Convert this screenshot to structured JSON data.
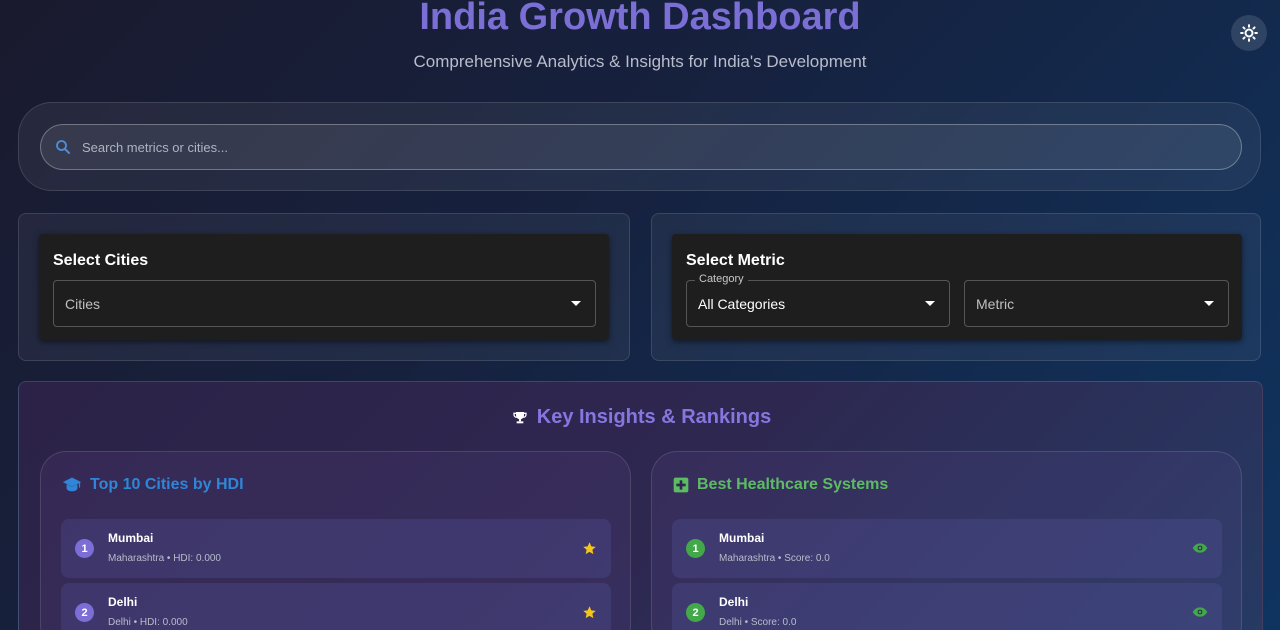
{
  "header": {
    "title": "India Growth Dashboard",
    "subtitle": "Comprehensive Analytics & Insights for India's Development"
  },
  "search": {
    "placeholder": "Search metrics or cities..."
  },
  "cities_panel": {
    "title": "Select Cities",
    "select_placeholder": "Cities"
  },
  "metric_panel": {
    "title": "Select Metric",
    "category_label": "Category",
    "category_value": "All Categories",
    "metric_placeholder": "Metric"
  },
  "insights": {
    "title": "Key Insights & Rankings",
    "hdi": {
      "title": "Top 10 Cities by HDI",
      "items": [
        {
          "rank": "1",
          "name": "Mumbai",
          "detail": "Maharashtra • HDI: 0.000"
        },
        {
          "rank": "2",
          "name": "Delhi",
          "detail": "Delhi • HDI: 0.000"
        }
      ]
    },
    "healthcare": {
      "title": "Best Healthcare Systems",
      "items": [
        {
          "rank": "1",
          "name": "Mumbai",
          "detail": "Maharashtra • Score: 0.0"
        },
        {
          "rank": "2",
          "name": "Delhi",
          "detail": "Delhi • Score: 0.0"
        }
      ]
    }
  },
  "icons": {
    "theme_toggle": "sun-icon",
    "search": "search-icon",
    "insights": "trophy-icon",
    "hdi": "graduation-cap-icon",
    "healthcare": "medical-cross-icon",
    "hdi_action": "star-icon",
    "healthcare_action": "eye-icon"
  },
  "colors": {
    "accent": "#7b6fd6",
    "hdi": "#2f86d8",
    "healthcare": "#5dbb63",
    "star": "#f5c518"
  }
}
